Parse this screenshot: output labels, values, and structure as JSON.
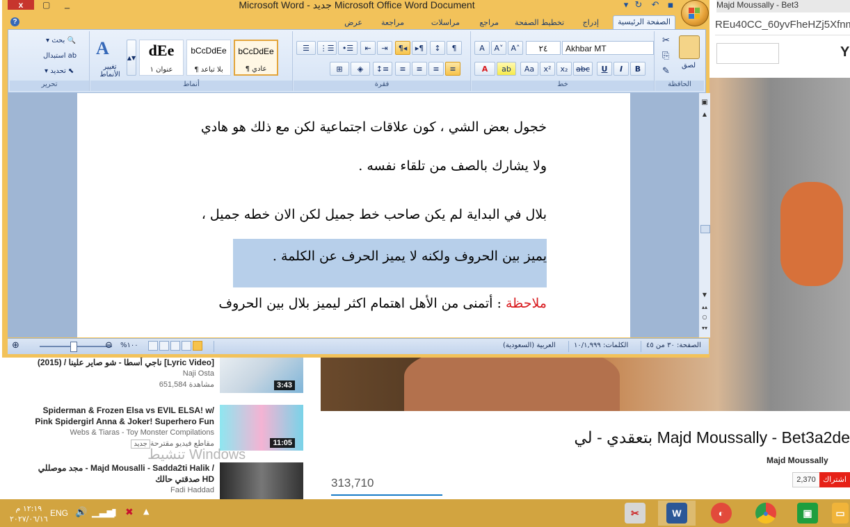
{
  "word": {
    "title": "Microsoft Word - جديد Microsoft Office Word Document",
    "close_label": "x",
    "tabs": [
      "الصفحة الرئيسية",
      "إدراج",
      "تخطيط الصفحة",
      "مراجع",
      "مراسلات",
      "مراجعة",
      "عرض"
    ],
    "groups": {
      "clipboard": {
        "label": "الحافظة",
        "paste": "لصق"
      },
      "font": {
        "label": "خط",
        "name": "Akhbar MT",
        "size": "٢٤"
      },
      "paragraph": {
        "label": "فقرة"
      },
      "styles": {
        "label": "أنماط",
        "change": "تغيير الأنماط",
        "items": [
          {
            "preview": "bCcDdEe",
            "name": "¶ عادي"
          },
          {
            "preview": "bCcDdEe",
            "name": "¶ بلا تباعد"
          },
          {
            "preview": "dEe",
            "name": "عنوان ١"
          }
        ]
      },
      "editing": {
        "label": "تحرير",
        "find": "بحث",
        "replace": "استبدال",
        "select": "تحديد"
      }
    },
    "document": {
      "lines": [
        "خجول بعض الشي ، كون علاقات اجتماعية لكن مع ذلك هو هادي",
        "ولا يشارك بالصف من تلقاء نفسه .",
        "بلال في البداية لم يكن صاحب خط جميل لكن الان خطه جميل ،",
        "يميز بين الحروف ولكنه لا يميز الحرف عن الكلمة ."
      ],
      "note_label": "ملاحظة",
      "note_text": " :  أتمنى من الأهل اهتمام اكثر ليميز بلال بين الحروف"
    },
    "status": {
      "page": "الصفحة: ٣٠ من ٤٥",
      "words": "الكلمات: ١٠/١,٩٩٩",
      "language": "العربية (السعودية)",
      "zoom": "%١٠٠",
      "zoom_percent": 100
    }
  },
  "browser": {
    "tab_title": "Majd Moussally - Bet3",
    "url": "REu40CC_60yvFheHZj5Xfnm",
    "logo_letter": "Y",
    "video_title": "Majd Moussally - Bet3a2de بتعقدي - لي",
    "channel": "Majd Moussally",
    "views": "313,710",
    "subscribe": "اشتراك",
    "subscribers": "2,370",
    "related": [
      {
        "title": "ناجي أسطا - شو صاير علينا / (2015) [Lyric Video]",
        "channel": "Naji Osta",
        "views": "651,584 مشاهدة",
        "duration": "3:43",
        "c1": "#dfe7ef",
        "c2": "#7fb5d8"
      },
      {
        "title": "Spiderman & Frozen Elsa vs EVIL ELSA! w/ Pink Spidergirl Anna & Joker! Superhero Fun",
        "channel": "Webs & Tiaras - Toy Monster Compilations",
        "views": "مقاطع فيديو مقترحة",
        "badge": "جديد",
        "duration": "11:05",
        "c1": "#7be0ee",
        "c2": "#f0a0c8"
      },
      {
        "title": "مجد موصللي - Majd Mousalli - Sadda2ti Halik / صدقتي حالك HD",
        "channel": "Fadi Haddad",
        "views": "",
        "duration": "",
        "c1": "#3a3a3a",
        "c2": "#6b6b6b"
      }
    ],
    "watermark": "تنشيط Windows"
  },
  "taskbar": {
    "time": "١٢:١٩ م",
    "date": "٢٠٢٧/٠٦/١٦",
    "lang": "ENG",
    "apps": [
      {
        "name": "paint",
        "color": "#d6d6d6",
        "glyph": "✂"
      },
      {
        "name": "word",
        "color": "#2b5797",
        "glyph": "W"
      },
      {
        "name": "media",
        "color": "#e24a3b",
        "glyph": "◐"
      },
      {
        "name": "chrome",
        "color": "#e8453c",
        "glyph": "◉"
      },
      {
        "name": "store",
        "color": "#1e9e3e",
        "glyph": "▣"
      },
      {
        "name": "explorer",
        "color": "#f0b43a",
        "glyph": "▭"
      }
    ]
  }
}
